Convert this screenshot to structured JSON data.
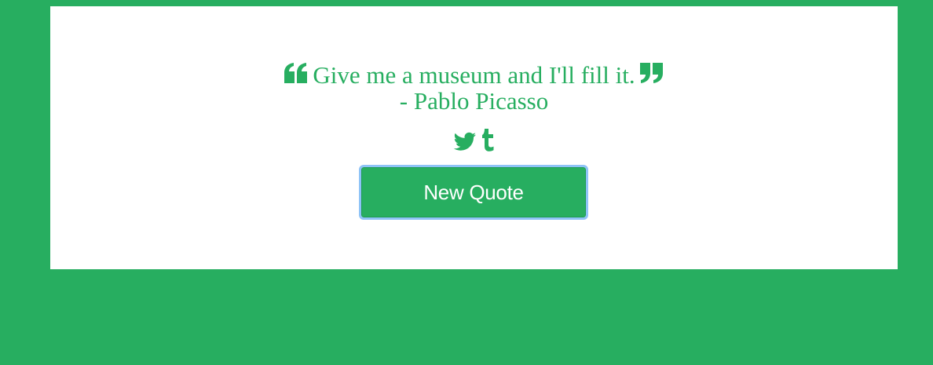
{
  "quote": {
    "text": "Give me a museum and I'll fill it.",
    "author": "- Pablo Picasso",
    "open_mark_icon": "quote-left-icon",
    "close_mark_icon": "quote-right-icon"
  },
  "share": {
    "twitter_icon": "twitter-icon",
    "tumblr_icon": "tumblr-icon"
  },
  "actions": {
    "new_quote_label": "New Quote"
  },
  "colors": {
    "background": "#27ae60",
    "card": "#ffffff",
    "accent": "#27ae60",
    "focus_ring": "#8ec3f7"
  }
}
